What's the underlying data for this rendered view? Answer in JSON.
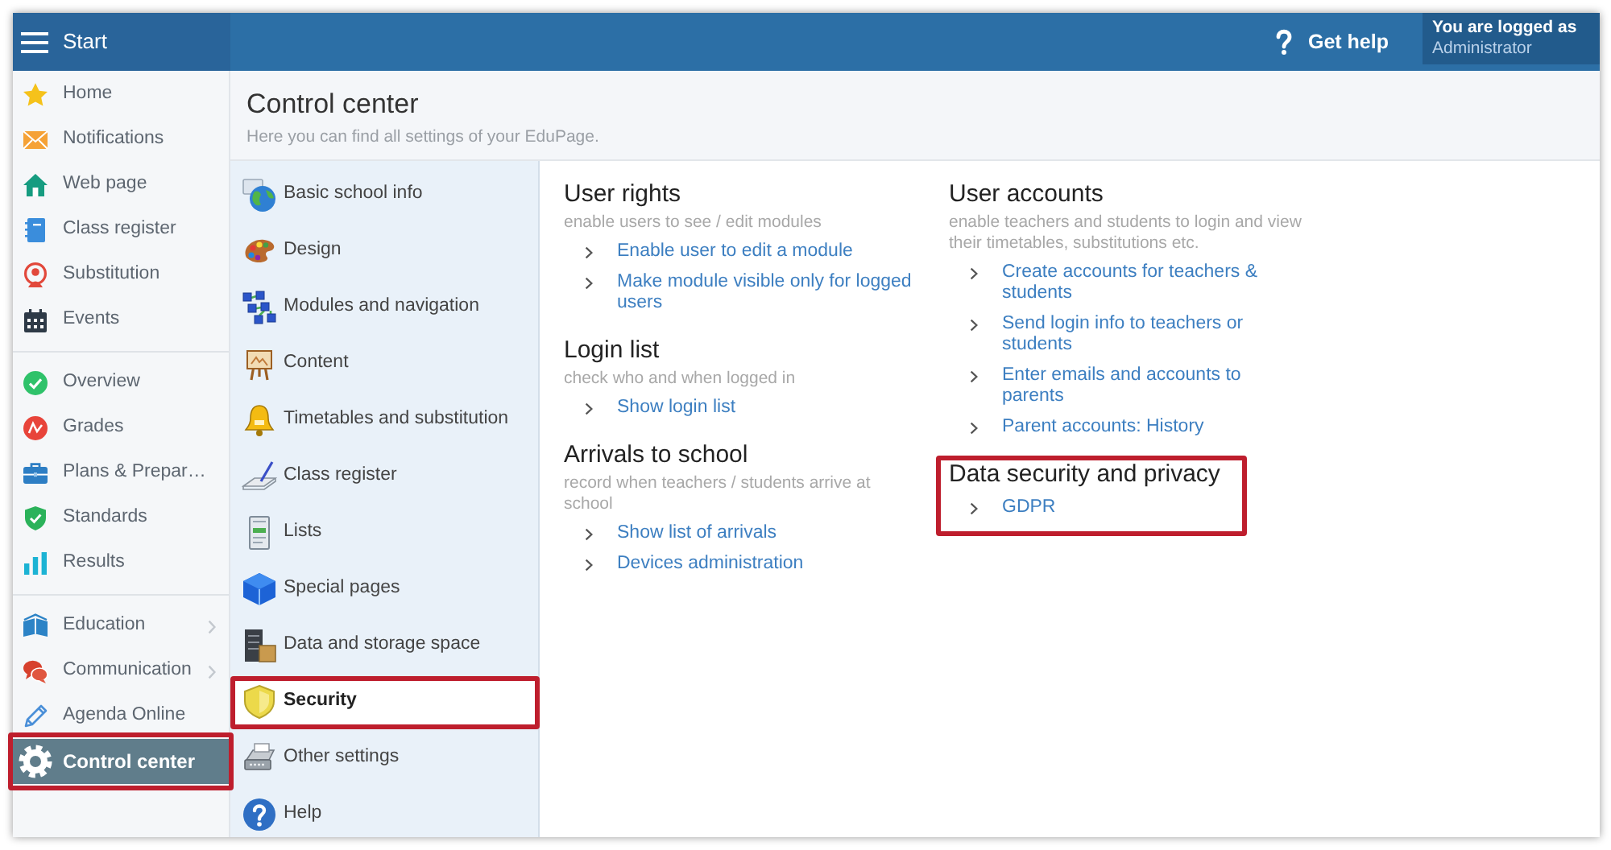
{
  "topbar": {
    "menu_label": "Start",
    "help_label": "Get help",
    "login_caption": "You are logged as",
    "user_name": "Administrator"
  },
  "sidebar": {
    "groups": [
      {
        "items": [
          {
            "label": "Home",
            "selected": false,
            "submenu": false,
            "highlighted": false
          },
          {
            "label": "Notifications",
            "selected": false,
            "submenu": false,
            "highlighted": false
          },
          {
            "label": "Web page",
            "selected": false,
            "submenu": false,
            "highlighted": false
          },
          {
            "label": "Class register",
            "selected": false,
            "submenu": false,
            "highlighted": false
          },
          {
            "label": "Substitution",
            "selected": false,
            "submenu": false,
            "highlighted": false
          },
          {
            "label": "Events",
            "selected": false,
            "submenu": false,
            "highlighted": false
          }
        ]
      },
      {
        "items": [
          {
            "label": "Overview",
            "selected": false,
            "submenu": false,
            "highlighted": false
          },
          {
            "label": "Grades",
            "selected": false,
            "submenu": false,
            "highlighted": false
          },
          {
            "label": "Plans & Prepar…",
            "selected": false,
            "submenu": false,
            "highlighted": false
          },
          {
            "label": "Standards",
            "selected": false,
            "submenu": false,
            "highlighted": false
          },
          {
            "label": "Results",
            "selected": false,
            "submenu": false,
            "highlighted": false
          }
        ]
      },
      {
        "items": [
          {
            "label": "Education",
            "selected": false,
            "submenu": true,
            "highlighted": false
          },
          {
            "label": "Communication",
            "selected": false,
            "submenu": true,
            "highlighted": false
          },
          {
            "label": "Agenda Online",
            "selected": false,
            "submenu": false,
            "highlighted": false
          },
          {
            "label": "Control center",
            "selected": true,
            "submenu": false,
            "highlighted": true
          }
        ]
      }
    ]
  },
  "header": {
    "title": "Control center",
    "subtitle": "Here you can find all settings of your EduPage."
  },
  "settings_menu": {
    "items": [
      {
        "label": "Basic school info",
        "selected": false,
        "highlighted": false
      },
      {
        "label": "Design",
        "selected": false,
        "highlighted": false
      },
      {
        "label": "Modules and navigation",
        "selected": false,
        "highlighted": false
      },
      {
        "label": "Content",
        "selected": false,
        "highlighted": false
      },
      {
        "label": "Timetables and substitution",
        "selected": false,
        "highlighted": false
      },
      {
        "label": "Class register",
        "selected": false,
        "highlighted": false
      },
      {
        "label": "Lists",
        "selected": false,
        "highlighted": false
      },
      {
        "label": "Special pages",
        "selected": false,
        "highlighted": false
      },
      {
        "label": "Data and storage space",
        "selected": false,
        "highlighted": false
      },
      {
        "label": "Security",
        "selected": true,
        "highlighted": true
      },
      {
        "label": "Other settings",
        "selected": false,
        "highlighted": false
      },
      {
        "label": "Help",
        "selected": false,
        "highlighted": false
      }
    ]
  },
  "content": {
    "columns": [
      {
        "sections": [
          {
            "title": "User rights",
            "description": "enable users to see / edit modules",
            "links": [
              "Enable user to edit a module",
              "Make module visible only for logged users"
            ],
            "highlighted": false
          },
          {
            "title": "Login list",
            "description": "check who and when logged in",
            "links": [
              "Show login list"
            ],
            "highlighted": false
          },
          {
            "title": "Arrivals to school",
            "description": "record when teachers / students arrive at school",
            "links": [
              "Show list of arrivals",
              "Devices administration"
            ],
            "highlighted": false
          }
        ]
      },
      {
        "sections": [
          {
            "title": "User accounts",
            "description": "enable teachers and students to login and view their timetables, substitutions etc.",
            "links": [
              "Create accounts for teachers & students",
              "Send login info to teachers or students",
              "Enter emails and accounts to parents",
              "Parent accounts: History"
            ],
            "highlighted": false
          },
          {
            "title": "Data security and privacy",
            "links": [
              "GDPR"
            ],
            "highlighted": true
          }
        ]
      }
    ]
  }
}
